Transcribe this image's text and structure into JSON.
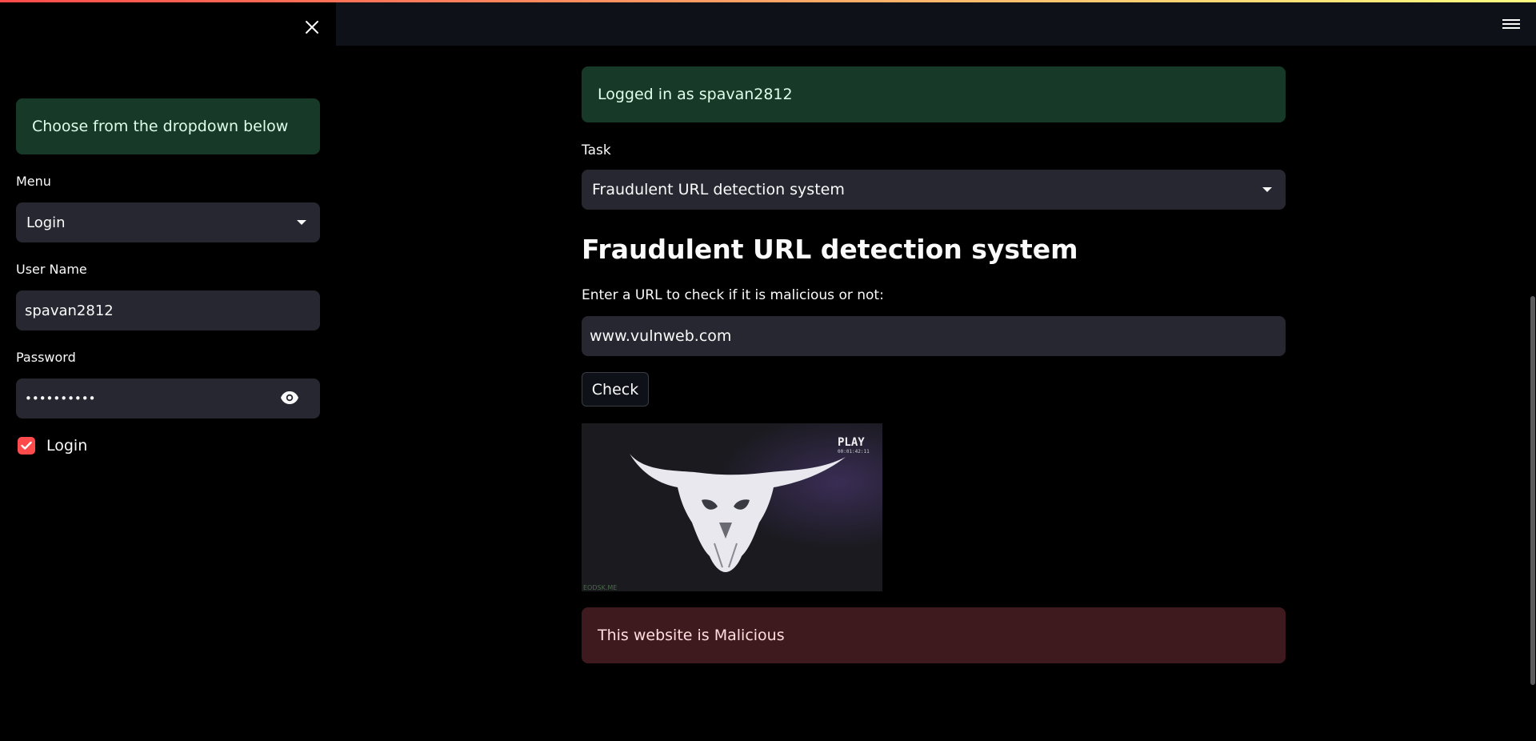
{
  "colors": {
    "accent": "#ff4b4b",
    "success_bg": "#173928",
    "error_bg": "#3e1a1e",
    "input_bg": "#262730"
  },
  "sidebar": {
    "info": "Choose from the dropdown below",
    "menu_label": "Menu",
    "menu_value": "Login",
    "username_label": "User Name",
    "username_value": "spavan2812",
    "password_label": "Password",
    "password_value": "••••••••••",
    "login_checkbox_label": "Login",
    "login_checked": true
  },
  "main": {
    "status": "Logged in as spavan2812",
    "task_label": "Task",
    "task_value": "Fraudulent URL detection system",
    "title": "Fraudulent URL detection system",
    "url_prompt": "Enter a URL to check if it is malicious or not:",
    "url_value": "www.vulnweb.com",
    "check_button": "Check",
    "image": {
      "play_text": "PLAY",
      "timecode": "00:01:42:11",
      "watermark": "EODSK.ME"
    },
    "result": "This website is Malicious"
  }
}
